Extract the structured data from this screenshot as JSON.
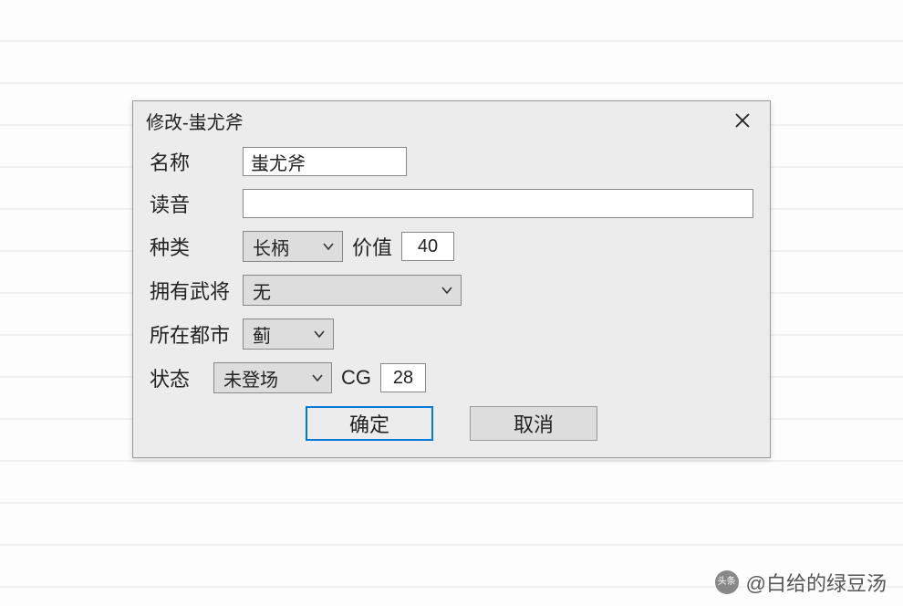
{
  "dialog": {
    "title": "修改-蚩尤斧",
    "fields": {
      "name_label": "名称",
      "name_value": "蚩尤斧",
      "reading_label": "读音",
      "reading_value": "",
      "type_label": "种类",
      "type_value": "长柄",
      "value_label": "价值",
      "value_value": "40",
      "owner_label": "拥有武将",
      "owner_value": "无",
      "city_label": "所在都市",
      "city_value": "蓟",
      "status_label": "状态",
      "status_value": "未登场",
      "cg_label": "CG",
      "cg_value": "28"
    },
    "buttons": {
      "ok": "确定",
      "cancel": "取消"
    }
  },
  "watermark": {
    "brand": "头条",
    "handle": "@白给的绿豆汤"
  }
}
